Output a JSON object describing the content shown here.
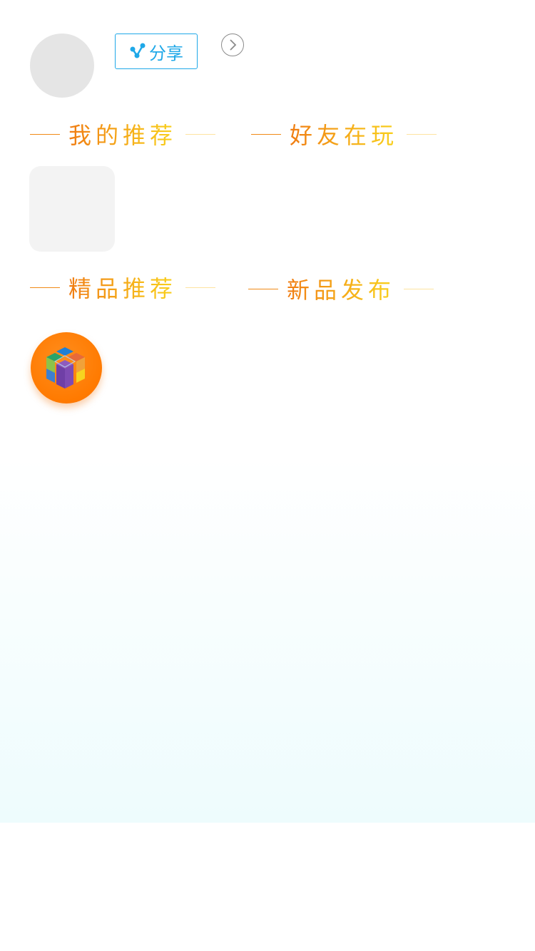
{
  "header": {
    "share_label": "分享",
    "share_icon": "share-icon",
    "next_icon": "chevron-right-icon"
  },
  "sections": {
    "my_recommend": "我的推荐",
    "friends_playing": "好友在玩",
    "featured": "精品推荐",
    "new_release": "新品发布"
  },
  "colors": {
    "accent_blue": "#1fa8e8",
    "title_orange": "#f07c12",
    "title_yellow": "#f9d21c",
    "icon_bg_orange": "#ff7a00"
  },
  "icons": {
    "app_icon": "cube-app-icon"
  }
}
